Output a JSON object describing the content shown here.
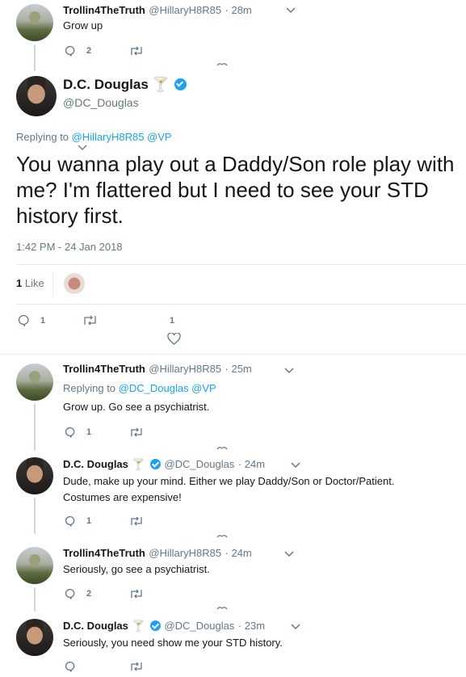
{
  "tweets": [
    {
      "name": "Trollin4TheTruth",
      "handle": "@HillaryH8R85",
      "time": "· 28m",
      "text": "Grow up",
      "replies": "2"
    },
    {
      "name": "Trollin4TheTruth",
      "handle": "@HillaryH8R85",
      "time": "· 25m",
      "replying_prefix": "Replying to",
      "replying_to": "@DC_Douglas @VP",
      "text": "Grow up. Go see a psychiatrist.",
      "replies": "1"
    },
    {
      "name": "D.C. Douglas",
      "emoji": "🍸",
      "handle": "@DC_Douglas",
      "time": "· 24m",
      "text": "Dude, make up your mind. Either we play Daddy/Son or Doctor/Patient. Costumes are expensive!",
      "replies": "1"
    },
    {
      "name": "Trollin4TheTruth",
      "handle": "@HillaryH8R85",
      "time": "· 24m",
      "text": "Seriously, go see a psychiatrist.",
      "replies": "2"
    },
    {
      "name": "D.C. Douglas",
      "emoji": "🍸",
      "handle": "@DC_Douglas",
      "time": "· 23m",
      "text": "Seriously, you need show me your STD history.",
      "replies": ""
    }
  ],
  "main": {
    "name": "D.C. Douglas",
    "emoji": "🍸",
    "handle": "@DC_Douglas",
    "replying_prefix": "Replying to",
    "replying_to": "@HillaryH8R85 @VP",
    "text": "You wanna play out a Daddy/Son role play with me? I'm flattered but I need to see your STD history first.",
    "timestamp": "1:42 PM - 24 Jan 2018",
    "likes_count": "1",
    "likes_label": "Like",
    "reply_count": "1",
    "like_action_count": "1"
  },
  "colors": {
    "accent": "#1da1f2",
    "muted": "#657786",
    "line": "#ccd6dd"
  }
}
